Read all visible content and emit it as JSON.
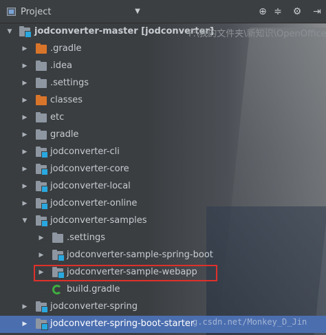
{
  "header": {
    "title": "Project",
    "dropdown_icon": "triangle-down-icon",
    "icons": [
      "target-icon",
      "collapse-icon",
      "gear-icon",
      "hide-icon"
    ]
  },
  "tree": {
    "root": {
      "label": "jodconverter-master [jodconverter]",
      "hint": "F:\\我的文件夹\\新知识\\OpenOffice"
    },
    "items": [
      {
        "label": ".gradle",
        "icon": "orange-folder"
      },
      {
        "label": ".idea",
        "icon": "folder"
      },
      {
        "label": ".settings",
        "icon": "folder"
      },
      {
        "label": "classes",
        "icon": "orange-folder"
      },
      {
        "label": "etc",
        "icon": "folder"
      },
      {
        "label": "gradle",
        "icon": "folder"
      },
      {
        "label": "jodconverter-cli",
        "icon": "module-folder"
      },
      {
        "label": "jodconverter-core",
        "icon": "module-folder"
      },
      {
        "label": "jodconverter-local",
        "icon": "module-folder"
      },
      {
        "label": "jodconverter-online",
        "icon": "module-folder"
      },
      {
        "label": "jodconverter-samples",
        "icon": "module-folder"
      },
      {
        "label": ".settings",
        "icon": "folder"
      },
      {
        "label": "jodconverter-sample-spring-boot",
        "icon": "module-folder"
      },
      {
        "label": "jodconverter-sample-webapp",
        "icon": "module-folder"
      },
      {
        "label": "build.gradle",
        "icon": "gradle-icon"
      },
      {
        "label": "jodconverter-spring",
        "icon": "module-folder"
      },
      {
        "label": "jodconverter-spring-boot-starter",
        "icon": "module-folder"
      }
    ]
  },
  "watermark": "g.csdn.net/Monkey_D_Jin",
  "colors": {
    "panel_bg": "#3c3f41",
    "selection": "#4b6eaf",
    "highlight_border": "#e0302a",
    "module_badge": "#29a8e0",
    "orange_folder": "#d9752a"
  }
}
